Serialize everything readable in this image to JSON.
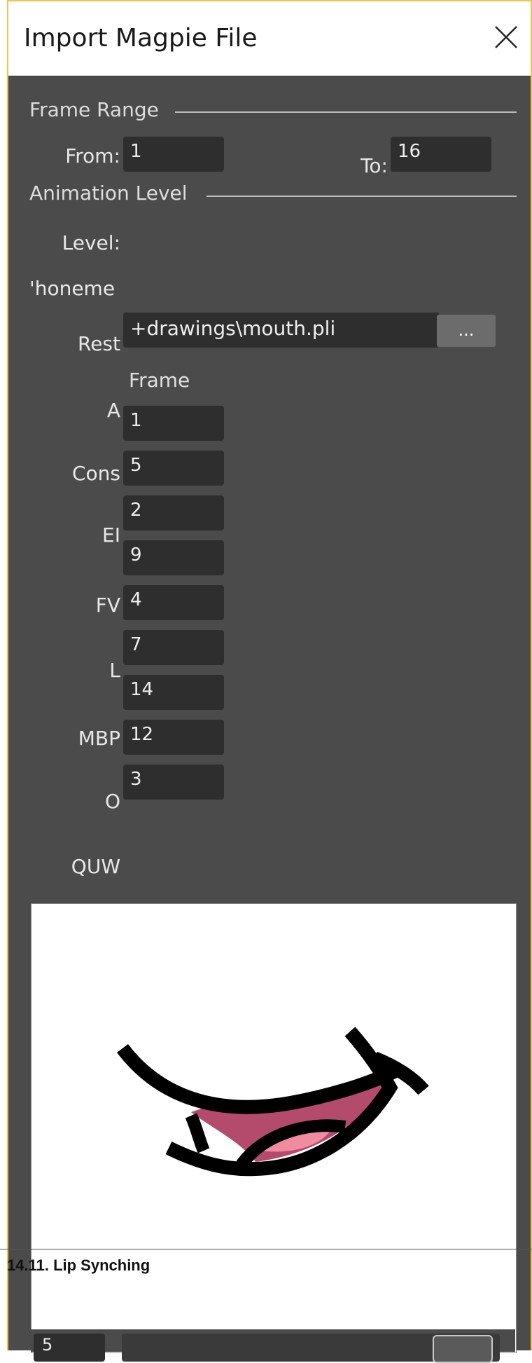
{
  "window": {
    "title": "Import Magpie File"
  },
  "frame_range": {
    "section_label": "Frame Range",
    "from_label": "From:",
    "from_value": "1",
    "to_label": "To:",
    "to_value": "16"
  },
  "animation_level": {
    "section_label": "Animation Level",
    "level_label": "Level:",
    "phoneme_label": "'honeme",
    "rest_label": "Rest",
    "rest_path": "+drawings\\mouth.pli",
    "browse_label": "...",
    "frame_column_label": "Frame"
  },
  "phonemes": [
    {
      "label": "A",
      "values": [
        "1"
      ]
    },
    {
      "label": "Cons",
      "values": [
        "5"
      ]
    },
    {
      "label": "EI",
      "values": [
        "2",
        "9"
      ]
    },
    {
      "label": "FV",
      "values": [
        "4"
      ]
    },
    {
      "label": "L",
      "values": [
        "7",
        "14"
      ]
    },
    {
      "label": "MBP",
      "values": [
        "12"
      ]
    },
    {
      "label": "O",
      "values": [
        "3"
      ]
    },
    {
      "label": "QUW",
      "values": []
    }
  ],
  "preview": {
    "frame_value": "5",
    "slider_level": 0.85,
    "colors": {
      "outline": "#000000",
      "lip": "#b54b6c",
      "tongue": "#f08ca0"
    }
  },
  "overlay": {
    "caption": "14.11.  Lip Synching"
  }
}
